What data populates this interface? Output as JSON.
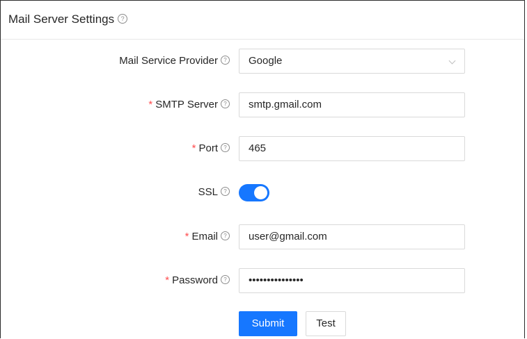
{
  "panel": {
    "title": "Mail Server Settings",
    "help_icon": "?"
  },
  "form": {
    "provider": {
      "label": "Mail Service Provider",
      "value": "Google",
      "required": false
    },
    "smtp": {
      "label": "SMTP Server",
      "value": "smtp.gmail.com",
      "required": true
    },
    "port": {
      "label": "Port",
      "value": "465",
      "required": true
    },
    "ssl": {
      "label": "SSL",
      "enabled": true
    },
    "email": {
      "label": "Email",
      "value": "user@gmail.com",
      "required": true
    },
    "password": {
      "label": "Password",
      "value": "•••••••••••••••",
      "required": true
    },
    "required_mark": "*"
  },
  "actions": {
    "submit_label": "Submit",
    "test_label": "Test"
  },
  "colors": {
    "primary": "#1677ff",
    "required": "#ff4d4f",
    "border": "#d9d9d9"
  },
  "icons": {
    "help": "question-circle-icon",
    "select_arrow": "chevron-down-icon"
  }
}
